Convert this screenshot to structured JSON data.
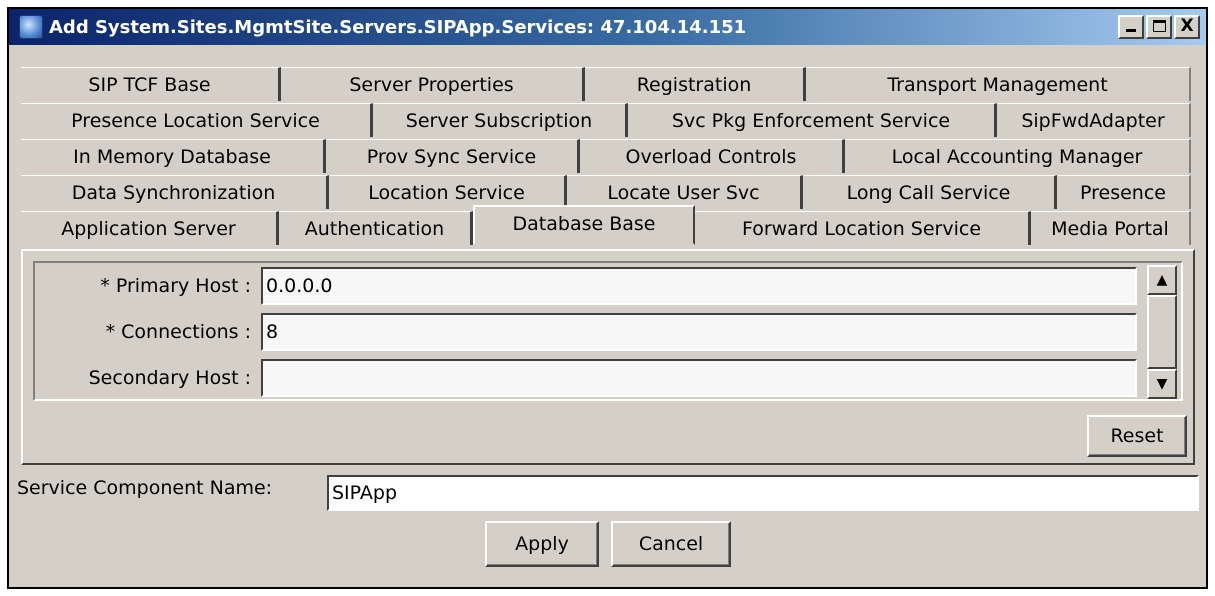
{
  "window": {
    "title": "Add System.Sites.MgmtSite.Servers.SIPApp.Services: 47.104.14.151",
    "buttons": {
      "minimize": "_",
      "maximize": "□",
      "close": "X"
    }
  },
  "tabs": {
    "row1": [
      "SIP TCF Base",
      "Server Properties",
      "Registration",
      "Transport Management"
    ],
    "row2": [
      "Presence Location Service",
      "Server Subscription",
      "Svc Pkg Enforcement Service",
      "SipFwdAdapter"
    ],
    "row3": [
      "In Memory Database",
      "Prov Sync Service",
      "Overload Controls",
      "Local Accounting Manager"
    ],
    "row4": [
      "Data Synchronization",
      "Location Service",
      "Locate User Svc",
      "Long Call Service",
      "Presence"
    ],
    "row5": [
      "Application Server",
      "Authentication",
      "Database Base",
      "Forward Location Service",
      "Media Portal"
    ],
    "active": "Database Base"
  },
  "form": {
    "primary_host_label": "* Primary Host :",
    "primary_host_value": "0.0.0.0",
    "connections_label": "* Connections :",
    "connections_value": "8",
    "secondary_host_label": "Secondary Host :",
    "secondary_host_value": ""
  },
  "reset_label": "Reset",
  "service_component": {
    "label": "Service Component Name:",
    "value": "SIPApp"
  },
  "actions": {
    "apply": "Apply",
    "cancel": "Cancel"
  }
}
